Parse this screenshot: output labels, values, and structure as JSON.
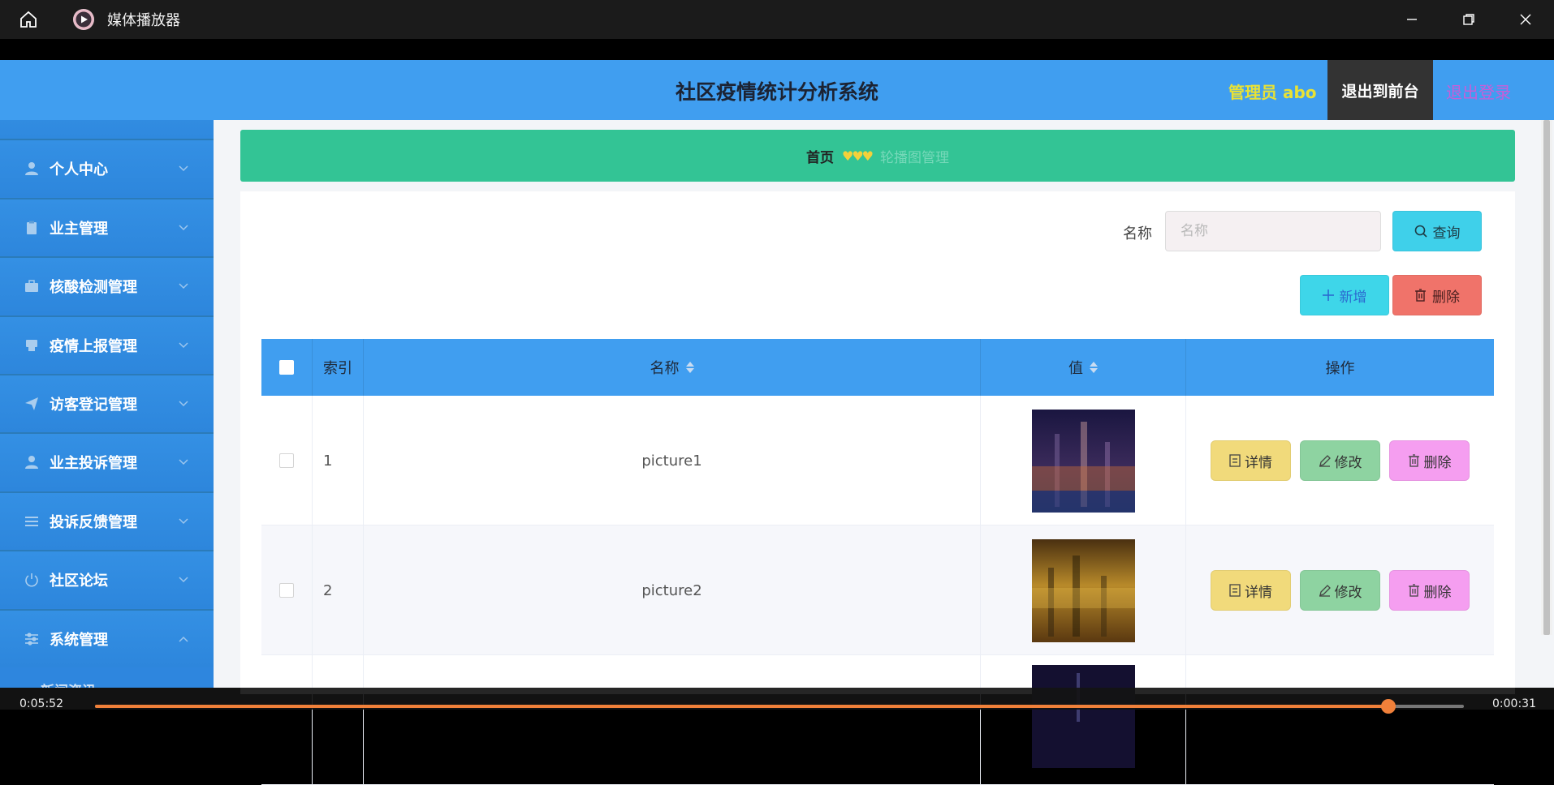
{
  "window": {
    "title": "媒体播放器"
  },
  "header": {
    "title": "社区疫情统计分析系统",
    "admin": "管理员 abo",
    "front": "退出到前台",
    "logout": "退出登录"
  },
  "sidebar": {
    "items": [
      {
        "label": "个人中心",
        "icon": "user-icon"
      },
      {
        "label": "业主管理",
        "icon": "clipboard-icon"
      },
      {
        "label": "核酸检测管理",
        "icon": "briefcase-icon"
      },
      {
        "label": "疫情上报管理",
        "icon": "printer-icon"
      },
      {
        "label": "访客登记管理",
        "icon": "send-icon"
      },
      {
        "label": "业主投诉管理",
        "icon": "user-icon"
      },
      {
        "label": "投诉反馈管理",
        "icon": "list-icon"
      },
      {
        "label": "社区论坛",
        "icon": "power-icon"
      },
      {
        "label": "系统管理",
        "icon": "sliders-icon"
      }
    ],
    "sub_item": "新闻资讯"
  },
  "breadcrumb": {
    "home": "首页",
    "sep": "♥♥♥",
    "current": "轮播图管理"
  },
  "search": {
    "label": "名称",
    "placeholder": "名称",
    "query": "查询"
  },
  "actions": {
    "add": "新增",
    "delete": "删除"
  },
  "table": {
    "headers": {
      "index": "索引",
      "name": "名称",
      "value": "值",
      "ops": "操作"
    },
    "rows": [
      {
        "index": "1",
        "name": "picture1"
      },
      {
        "index": "2",
        "name": "picture2"
      }
    ],
    "ops": {
      "detail": "详情",
      "edit": "修改",
      "delete": "删除"
    }
  },
  "media": {
    "elapsed": "0:05:52",
    "remaining": "0:00:31",
    "progress": 0.945
  }
}
